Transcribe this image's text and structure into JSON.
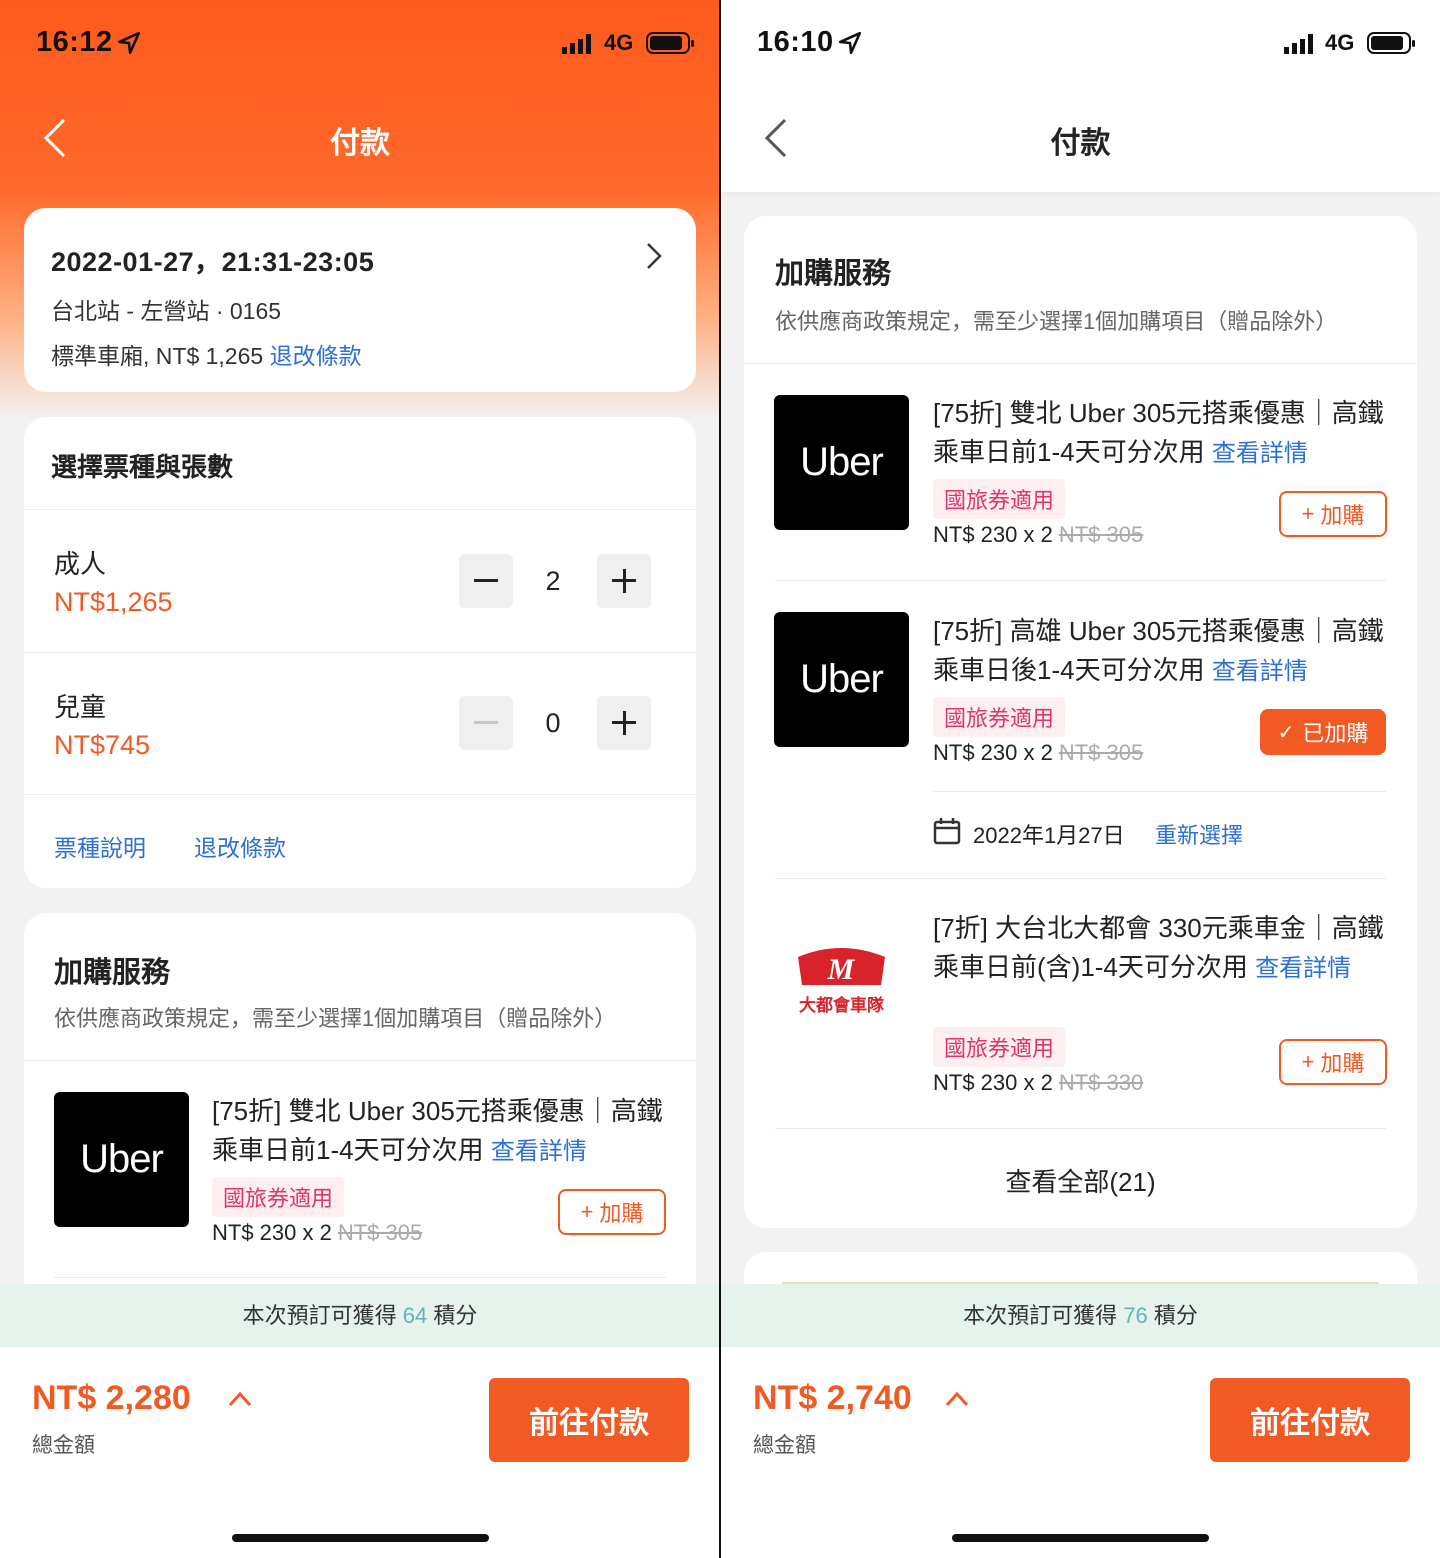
{
  "left": {
    "status": {
      "time": "16:12",
      "network": "4G"
    },
    "nav_title": "付款",
    "trip": {
      "datetime": "2022-01-27，21:31-23:05",
      "route": "台北站 - 左營站 · 0165",
      "fare": "標準車廂, NT$ 1,265",
      "refund_link": "退改條款"
    },
    "tickets": {
      "heading": "選擇票種與張數",
      "rows": [
        {
          "type": "成人",
          "price": "NT$1,265",
          "qty": "2"
        },
        {
          "type": "兒童",
          "price": "NT$745",
          "qty": "0"
        }
      ],
      "link_1": "票種說明",
      "link_2": "退改條款"
    },
    "addons": {
      "heading": "加購服務",
      "subtitle": "依供應商政策規定，需至少選擇1個加購項目（贈品除外）",
      "items": [
        {
          "logo": "Uber",
          "title": "[75折] 雙北 Uber 305元搭乘優惠｜高鐵乘車日前1-4天可分次用",
          "detail_link": "查看詳情",
          "badge": "國旅券適用",
          "price": "NT$ 230 x 2",
          "original_price": "NT$ 305",
          "button": "加購"
        }
      ]
    },
    "points": {
      "prefix": "本次預訂可獲得",
      "value": "64",
      "suffix": "積分"
    },
    "footer": {
      "total": "NT$ 2,280",
      "total_label": "總金額",
      "pay_button": "前往付款"
    }
  },
  "right": {
    "status": {
      "time": "16:10",
      "network": "4G"
    },
    "nav_title": "付款",
    "addons": {
      "heading": "加購服務",
      "subtitle": "依供應商政策規定，需至少選擇1個加購項目（贈品除外）",
      "items": [
        {
          "logo": "Uber",
          "title": "[75折] 雙北 Uber 305元搭乘優惠｜高鐵乘車日前1-4天可分次用",
          "detail_link": "查看詳情",
          "badge": "國旅券適用",
          "price": "NT$ 230 x 2",
          "original_price": "NT$ 305",
          "button": "加購"
        },
        {
          "logo": "Uber",
          "title": "[75折] 高雄 Uber 305元搭乘優惠｜高鐵乘車日後1-4天可分次用",
          "detail_link": "查看詳情",
          "badge": "國旅券適用",
          "price": "NT$ 230 x 2",
          "original_price": "NT$ 305",
          "button": "已加購",
          "date": "2022年1月27日",
          "reselect": "重新選擇"
        },
        {
          "logo": "大都會車隊",
          "title": "[7折] 大台北大都會 330元乘車金｜高鐵乘車日前(含)1-4天可分次用",
          "detail_link": "查看詳情",
          "badge": "國旅券適用",
          "price": "NT$ 230 x 2",
          "original_price": "NT$ 330",
          "button": "加購"
        }
      ],
      "view_all": "查看全部(21)"
    },
    "points": {
      "prefix": "本次預訂可獲得",
      "value": "76",
      "suffix": "積分"
    },
    "footer": {
      "total": "NT$ 2,740",
      "total_label": "總金額",
      "pay_button": "前往付款"
    }
  },
  "colors": {
    "accent": "#f25a24",
    "link": "#2d6fd9",
    "badge_text": "#e2336b",
    "points_bg": "#e6f3ec"
  }
}
